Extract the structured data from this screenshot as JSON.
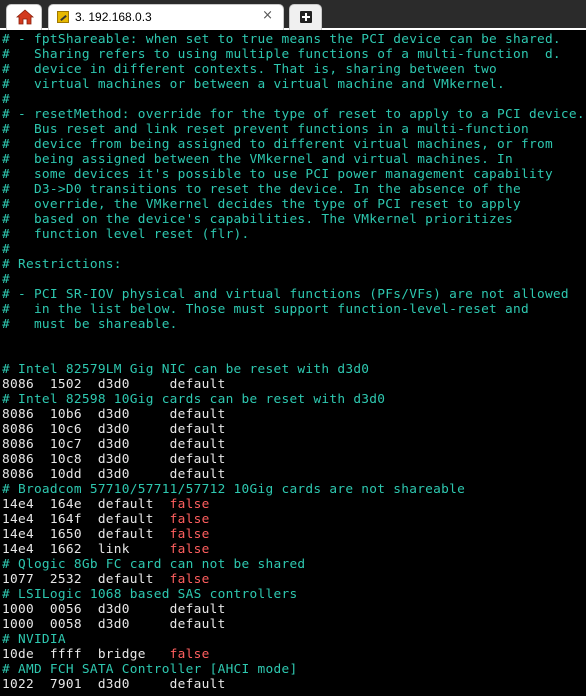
{
  "tabs": {
    "home_icon": "home-icon",
    "session_icon": "wrench-terminal-icon",
    "session_title": "3. 192.168.0.3",
    "close_glyph": "×",
    "new_tab_icon": "plus-icon"
  },
  "colors": {
    "comment": "#2ec8b0",
    "data": "#e8e8e8",
    "false_value": "#ff5f5f",
    "background": "#000000"
  },
  "terminal": {
    "lines": [
      {
        "type": "comment",
        "text": "# - fptShareable: when set to true means the PCI device can be shared."
      },
      {
        "type": "comment",
        "text": "#   Sharing refers to using multiple functions of a multi-function  d."
      },
      {
        "type": "comment",
        "text": "#   device in different contexts. That is, sharing between two"
      },
      {
        "type": "comment",
        "text": "#   virtual machines or between a virtual machine and VMkernel."
      },
      {
        "type": "comment",
        "text": "#"
      },
      {
        "type": "comment",
        "text": "# - resetMethod: override for the type of reset to apply to a PCI device."
      },
      {
        "type": "comment",
        "text": "#   Bus reset and link reset prevent functions in a multi-function"
      },
      {
        "type": "comment",
        "text": "#   device from being assigned to different virtual machines, or from"
      },
      {
        "type": "comment",
        "text": "#   being assigned between the VMkernel and virtual machines. In"
      },
      {
        "type": "comment",
        "text": "#   some devices it's possible to use PCI power management capability"
      },
      {
        "type": "comment",
        "text": "#   D3->D0 transitions to reset the device. In the absence of the"
      },
      {
        "type": "comment",
        "text": "#   override, the VMkernel decides the type of PCI reset to apply"
      },
      {
        "type": "comment",
        "text": "#   based on the device's capabilities. The VMkernel prioritizes"
      },
      {
        "type": "comment",
        "text": "#   function level reset (flr)."
      },
      {
        "type": "comment",
        "text": "#"
      },
      {
        "type": "comment",
        "text": "# Restrictions:"
      },
      {
        "type": "comment",
        "text": "#"
      },
      {
        "type": "comment",
        "text": "# - PCI SR-IOV physical and virtual functions (PFs/VFs) are not allowed"
      },
      {
        "type": "comment",
        "text": "#   in the list below. Those must support function-level-reset and"
      },
      {
        "type": "comment",
        "text": "#   must be shareable."
      },
      {
        "type": "blank",
        "text": ""
      },
      {
        "type": "blank",
        "text": ""
      },
      {
        "type": "comment",
        "text": "# Intel 82579LM Gig NIC can be reset with d3d0"
      },
      {
        "type": "data",
        "text": "8086  1502  d3d0     default",
        "flag": ""
      },
      {
        "type": "comment",
        "text": "# Intel 82598 10Gig cards can be reset with d3d0"
      },
      {
        "type": "data",
        "text": "8086  10b6  d3d0     default",
        "flag": ""
      },
      {
        "type": "data",
        "text": "8086  10c6  d3d0     default",
        "flag": ""
      },
      {
        "type": "data",
        "text": "8086  10c7  d3d0     default",
        "flag": ""
      },
      {
        "type": "data",
        "text": "8086  10c8  d3d0     default",
        "flag": ""
      },
      {
        "type": "data",
        "text": "8086  10dd  d3d0     default",
        "flag": ""
      },
      {
        "type": "comment",
        "text": "# Broadcom 57710/57711/57712 10Gig cards are not shareable"
      },
      {
        "type": "data",
        "text": "14e4  164e  default  ",
        "flag": "false"
      },
      {
        "type": "data",
        "text": "14e4  164f  default  ",
        "flag": "false"
      },
      {
        "type": "data",
        "text": "14e4  1650  default  ",
        "flag": "false"
      },
      {
        "type": "data",
        "text": "14e4  1662  link     ",
        "flag": "false"
      },
      {
        "type": "comment",
        "text": "# Qlogic 8Gb FC card can not be shared"
      },
      {
        "type": "data",
        "text": "1077  2532  default  ",
        "flag": "false"
      },
      {
        "type": "comment",
        "text": "# LSILogic 1068 based SAS controllers"
      },
      {
        "type": "data",
        "text": "1000  0056  d3d0     default",
        "flag": ""
      },
      {
        "type": "data",
        "text": "1000  0058  d3d0     default",
        "flag": ""
      },
      {
        "type": "comment",
        "text": "# NVIDIA"
      },
      {
        "type": "data",
        "text": "10de  ffff  bridge   ",
        "flag": "false"
      },
      {
        "type": "comment",
        "text": "# AMD FCH SATA Controller [AHCI mode]"
      },
      {
        "type": "data",
        "text": "1022  7901  d3d0     default",
        "flag": ""
      }
    ]
  }
}
